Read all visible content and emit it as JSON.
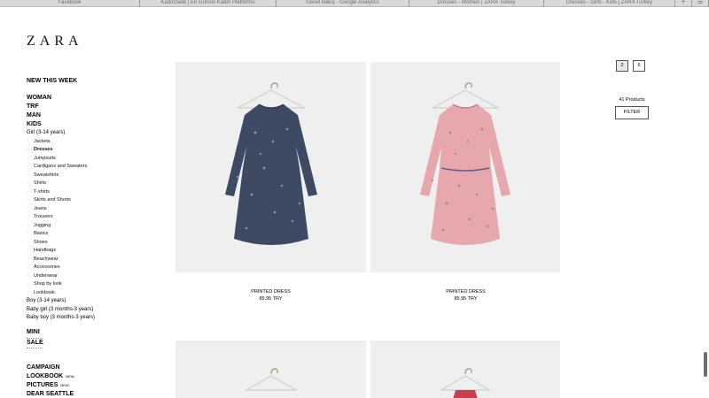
{
  "browser": {
    "tabs": [
      "Facebook",
      "Kadınzade | En Güncel Kadın Platformu",
      "Genel Bakış - Google Analytics",
      "Dresses - Women | ZARA Turkey",
      "Dresses - Girls - Kids | ZARA Turkey"
    ],
    "new_tab_label": "+",
    "menu_label": "☰"
  },
  "logo": "ZARA",
  "nav": {
    "new_this_week": "NEW THIS WEEK",
    "categories": [
      "WOMAN",
      "TRF",
      "MAN",
      "KIDS"
    ],
    "girl": "Girl (3-14 years)",
    "girl_items": [
      "Jackets",
      "Dresses",
      "Jumpsuits",
      "Cardigans and Sweaters",
      "Sweatshirts",
      "Shirts",
      "T-shirts",
      "Skirts and Shorts",
      "Jeans",
      "Trousers",
      "Jogging",
      "Basics",
      "Shoes",
      "Handbags",
      "Beachwear",
      "Accessories",
      "Underwear",
      "Shop by look",
      "Lookbook"
    ],
    "kids_other": [
      "Boy (3-14 years)",
      "Baby girl (3 months-3 years)",
      "Baby boy (3 months-3 years)"
    ],
    "mini": "MINI",
    "sale": "SALE",
    "campaign": "CAMPAIGN",
    "lookbook": "LOOKBOOK",
    "pictures": "PICTURES",
    "dear_seattle": "DEAR SEATTLE",
    "new_badge": "NEW"
  },
  "products": [
    {
      "name": "PRINTED DRESS",
      "price": "85.95 TRY",
      "color": "#3c4a64"
    },
    {
      "name": "PRINTED DRESS",
      "price": "85.95 TRY",
      "color": "#e6a7ad"
    }
  ],
  "view_options": [
    "2",
    "6"
  ],
  "products_count": "41 Products",
  "filter_label": "FILTER"
}
